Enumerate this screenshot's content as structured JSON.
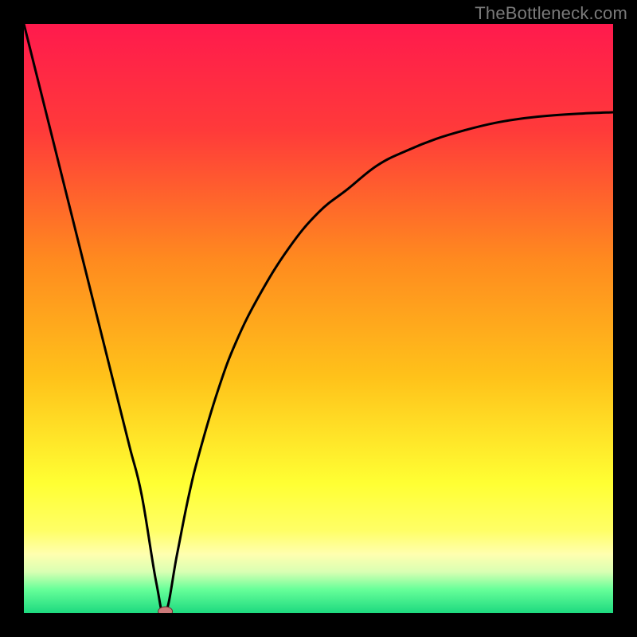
{
  "watermark": "TheBottleneck.com",
  "colors": {
    "background": "#000000",
    "curve": "#000000",
    "marker_fill": "#cc7a7a",
    "marker_stroke": "#6b2d2d",
    "gradient_stops": [
      {
        "offset": 0.0,
        "color": "#ff1a4d"
      },
      {
        "offset": 0.18,
        "color": "#ff3a3a"
      },
      {
        "offset": 0.4,
        "color": "#ff8a1f"
      },
      {
        "offset": 0.6,
        "color": "#ffc21a"
      },
      {
        "offset": 0.78,
        "color": "#ffff33"
      },
      {
        "offset": 0.86,
        "color": "#ffff66"
      },
      {
        "offset": 0.9,
        "color": "#ffffaf"
      },
      {
        "offset": 0.93,
        "color": "#d9ffb3"
      },
      {
        "offset": 0.96,
        "color": "#66ff99"
      },
      {
        "offset": 1.0,
        "color": "#1dd97f"
      }
    ]
  },
  "chart_data": {
    "type": "line",
    "title": "",
    "xlabel": "",
    "ylabel": "",
    "xlim": [
      0,
      100
    ],
    "ylim": [
      0,
      100
    ],
    "grid": false,
    "legend": false,
    "x": [
      0,
      2,
      4,
      6,
      8,
      10,
      12,
      14,
      16,
      18,
      20,
      22.5,
      24,
      26,
      28,
      30,
      33,
      36,
      40,
      45,
      50,
      55,
      60,
      65,
      70,
      75,
      80,
      85,
      90,
      95,
      100
    ],
    "values": [
      100,
      92,
      84,
      76,
      68,
      60,
      52,
      44,
      36,
      28,
      20,
      5,
      0,
      10,
      20,
      28,
      38,
      46,
      54,
      62,
      68,
      72,
      76,
      78.5,
      80.5,
      82,
      83.2,
      84,
      84.5,
      84.8,
      85
    ],
    "minimum_point": {
      "x": 24,
      "y": 0
    },
    "annotations": []
  }
}
